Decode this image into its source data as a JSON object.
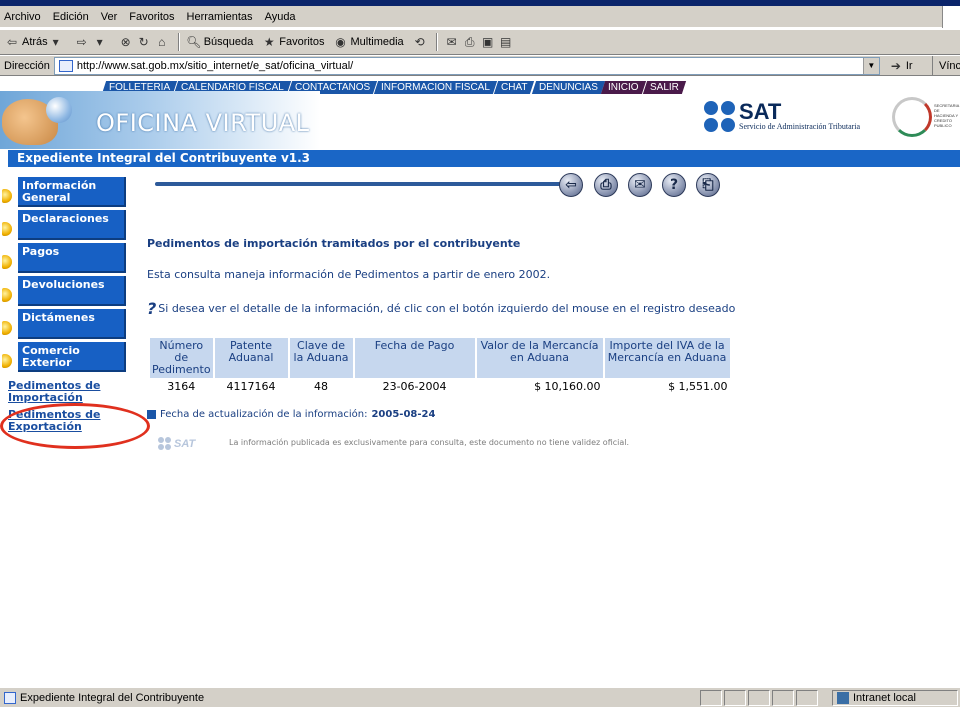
{
  "browser": {
    "menu": [
      "Archivo",
      "Edición",
      "Ver",
      "Favoritos",
      "Herramientas",
      "Ayuda"
    ],
    "toolbar": {
      "back": "Atrás",
      "search": "Búsqueda",
      "favorites": "Favoritos",
      "multimedia": "Multimedia"
    },
    "address_label": "Dirección",
    "address_url": "http://www.sat.gob.mx/sitio_internet/e_sat/oficina_virtual/",
    "go_label": "Ir",
    "links_label": "Vínculos",
    "status_text": "Expediente Integral del Contribuyente",
    "zone_text": "Intranet local"
  },
  "topnav": [
    "FOLLETERIA",
    "CALENDARIO FISCAL",
    "CONTACTANOS",
    "INFORMACION FISCAL",
    "CHAT",
    "DENUNCIAS",
    "INICIO",
    "SALIR"
  ],
  "banner": {
    "title": "OFICINA VIRTUAL"
  },
  "logo": {
    "name": "SAT",
    "subtitle": "Servicio de Administración Tributaria"
  },
  "shcp_text": "SECRETARIA DE HACIENDA Y CREDITO PUBLICO",
  "page_title": "Expediente Integral del Contribuyente v1.3",
  "leftnav": [
    {
      "label": "Información General"
    },
    {
      "label": "Declaraciones"
    },
    {
      "label": "Pagos"
    },
    {
      "label": "Devoluciones"
    },
    {
      "label": "Dictámenes"
    },
    {
      "label": "Comercio Exterior"
    }
  ],
  "sublinks": [
    {
      "label": "Pedimentos de Importación"
    },
    {
      "label": "Pedimentos de Exportación"
    }
  ],
  "main": {
    "title": "Pedimentos de importación tramitados por el contribuyente",
    "desc": "Esta consulta maneja información de Pedimentos a partir de enero 2002.",
    "help": "Si desea ver el detalle de la información, dé clic con el botón izquierdo del mouse en el registro deseado",
    "update_label": "Fecha de actualización de la información:",
    "update_date": "2005-08-24",
    "footer_note": "La información publicada es exclusivamente para consulta, este documento no tiene validez oficial.",
    "footer_logo": "SAT"
  },
  "table": {
    "headers": [
      "Número de Pedimento",
      "Patente Aduanal",
      "Clave de la Aduana",
      "Fecha de Pago",
      "Valor de la Mercancía en Aduana",
      "Importe del IVA de la Mercancía en Aduana"
    ],
    "rows": [
      [
        "3164",
        "4117164",
        "48",
        "23-06-2004",
        "$ 10,160.00",
        "$ 1,551.00"
      ]
    ]
  }
}
